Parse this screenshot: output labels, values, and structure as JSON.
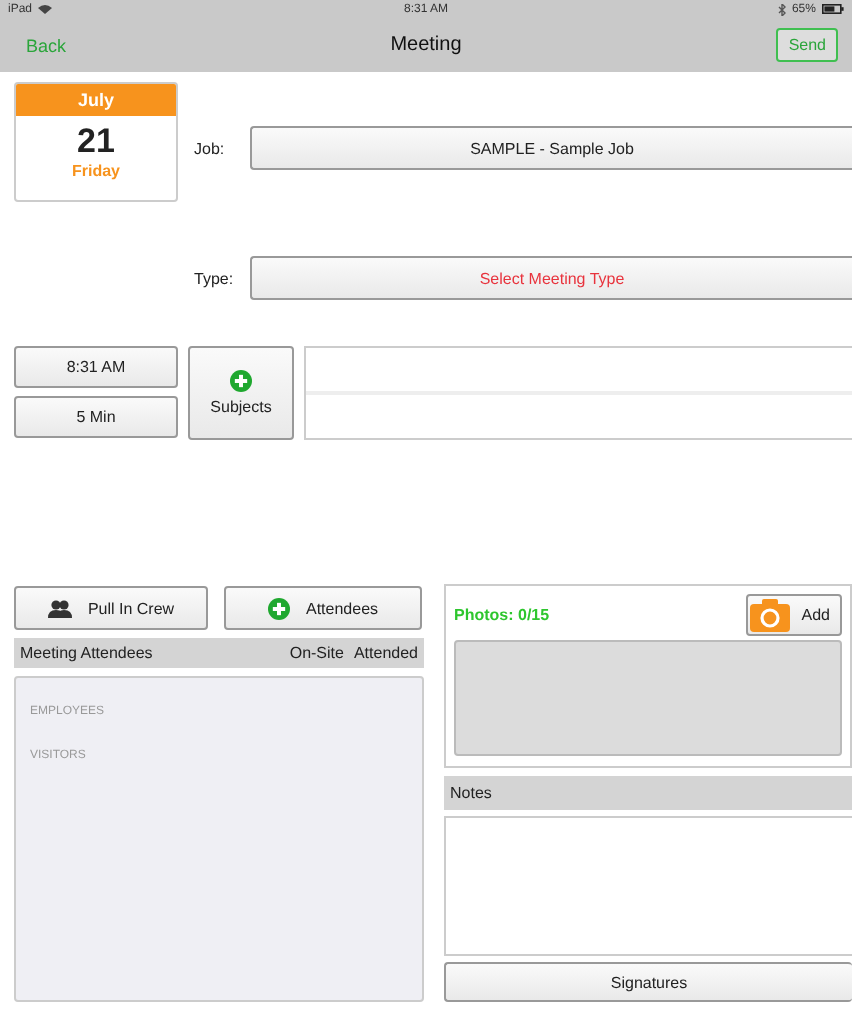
{
  "status_bar": {
    "device": "iPad",
    "time": "8:31 AM",
    "battery": "65%"
  },
  "nav": {
    "back": "Back",
    "title": "Meeting",
    "send": "Send"
  },
  "date": {
    "month": "July",
    "day": "21",
    "weekday": "Friday"
  },
  "job": {
    "label": "Job:",
    "value": "SAMPLE - Sample Job"
  },
  "type": {
    "label": "Type:",
    "value": "Select Meeting Type"
  },
  "time_button": "8:31 AM",
  "duration_button": "5 Min",
  "subjects_button": "Subjects",
  "crew_button": "Pull In Crew",
  "attendees_button": "Attendees",
  "attendees_header": {
    "title": "Meeting Attendees",
    "columns": [
      "On-Site",
      "Attended"
    ]
  },
  "attendee_sections": [
    "EMPLOYEES",
    "VISITORS"
  ],
  "photos": {
    "count": "Photos: 0/15",
    "add": "Add"
  },
  "notes": {
    "title": "Notes"
  },
  "signatures_button": "Signatures"
}
